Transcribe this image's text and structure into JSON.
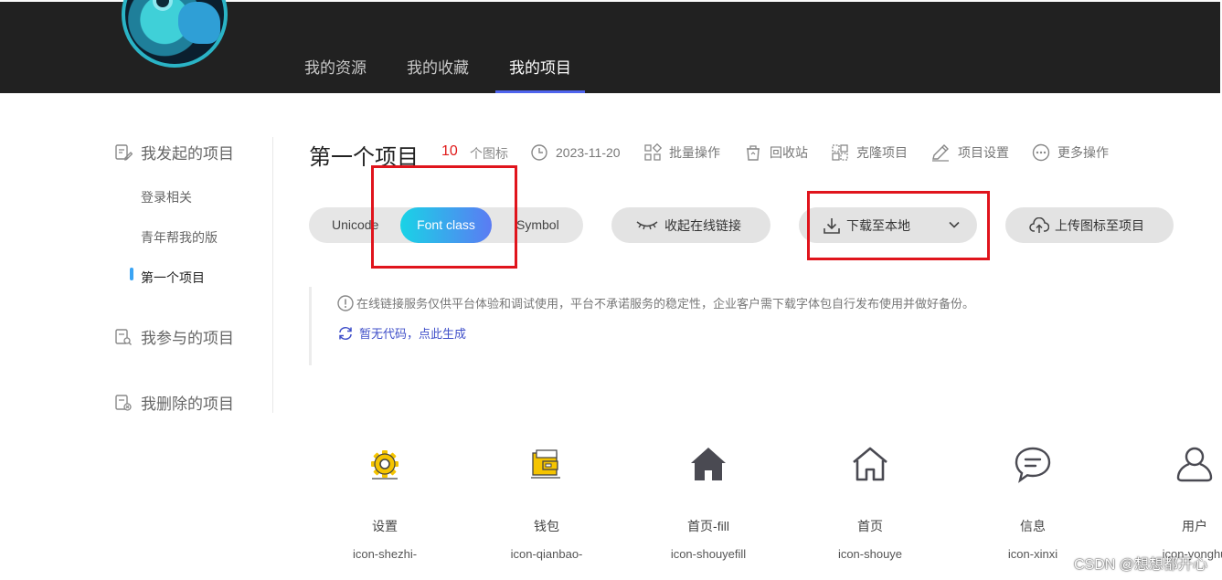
{
  "header": {
    "nav": [
      {
        "label": "我的资源",
        "active": false
      },
      {
        "label": "我的收藏",
        "active": false
      },
      {
        "label": "我的项目",
        "active": true
      }
    ],
    "accent": "#4f64ee"
  },
  "sidebar": {
    "groups": [
      {
        "label": "我发起的项目",
        "icon": "edit-doc-icon"
      },
      {
        "label": "我参与的项目",
        "icon": "search-doc-icon"
      },
      {
        "label": "我删除的项目",
        "icon": "delete-doc-icon"
      }
    ],
    "projects": [
      {
        "label": "登录相关",
        "active": false
      },
      {
        "label": "青年帮我的版",
        "active": false
      },
      {
        "label": "第一个项目",
        "active": true
      }
    ]
  },
  "project": {
    "title": "第一个项目",
    "icon_count": "10",
    "icon_count_label": "个图标",
    "date": "2023-11-20",
    "actions": [
      {
        "label": "批量操作",
        "icon": "batch-icon"
      },
      {
        "label": "回收站",
        "icon": "recycle-icon"
      },
      {
        "label": "克隆项目",
        "icon": "clone-icon"
      },
      {
        "label": "项目设置",
        "icon": "pencil-icon"
      },
      {
        "label": "更多操作",
        "icon": "more-icon"
      }
    ]
  },
  "toolbar": {
    "modes": [
      "Unicode",
      "Font class",
      "Symbol"
    ],
    "active_mode": "Font class",
    "collapse_link_label": "收起在线链接",
    "download_label": "下载至本地",
    "upload_label": "上传图标至项目"
  },
  "notice": {
    "text": "在线链接服务仅供平台体验和调试使用，平台不承诺服务的稳定性，企业客户需下载字体包自行发布使用并做好备份。",
    "generate_link": "暂无代码，点此生成"
  },
  "icons": [
    {
      "name": "设置",
      "code": "icon-shezhi-",
      "icon": "gear-icon"
    },
    {
      "name": "钱包",
      "code": "icon-qianbao-",
      "icon": "wallet-icon"
    },
    {
      "name": "首页-fill",
      "code": "icon-shouyefill",
      "icon": "home-fill-icon"
    },
    {
      "name": "首页",
      "code": "icon-shouye",
      "icon": "home-icon"
    },
    {
      "name": "信息",
      "code": "icon-xinxi",
      "icon": "message-icon"
    },
    {
      "name": "用户",
      "code": "icon-yonghu",
      "icon": "user-icon"
    }
  ],
  "watermark": "CSDN @想想都开心"
}
